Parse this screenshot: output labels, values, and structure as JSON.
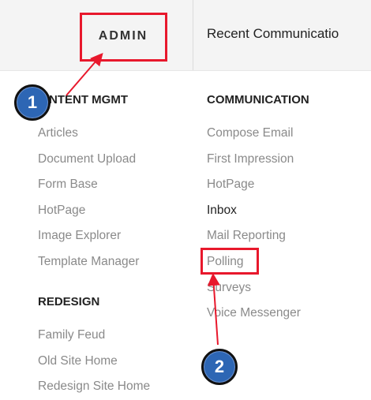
{
  "nav": {
    "admin_label": "ADMIN",
    "recent_label": "Recent Communicatio"
  },
  "columns": {
    "content": {
      "heading": "NTENT MGMT",
      "items": [
        "Articles",
        "Document Upload",
        "Form Base",
        "HotPage",
        "Image Explorer",
        "Template Manager"
      ]
    },
    "redesign": {
      "heading": "REDESIGN",
      "items": [
        "Family Feud",
        "Old Site Home",
        "Redesign Site Home"
      ]
    },
    "communication": {
      "heading": "COMMUNICATION",
      "items": [
        "Compose Email",
        "First Impression",
        "HotPage",
        "Inbox",
        "Mail Reporting",
        "Polling",
        "Surveys",
        "Voice Messenger"
      ]
    }
  },
  "annotations": {
    "step1": "1",
    "step2": "2",
    "highlight_color": "#e8182c",
    "badge_color": "#2d66b4"
  }
}
